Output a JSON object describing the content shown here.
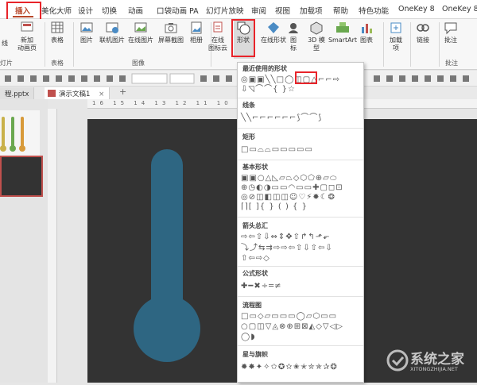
{
  "tabs": [
    "插入",
    "美化大师",
    "设计",
    "切换",
    "动画",
    "口袋动画 PA",
    "幻灯片放映",
    "审阅",
    "视图",
    "加载项",
    "帮助",
    "特色功能",
    "OneKey 8",
    "OneKey 8"
  ],
  "ribbon": {
    "b0": "线",
    "b0b": "片",
    "b1": "新加",
    "b1b": "动画页",
    "b2": "表格",
    "b3": "图片",
    "b4": "联机图片",
    "b5": "在线图片",
    "b6": "屏幕截图",
    "b7": "相册",
    "b8": "在线",
    "b8b": "图标云",
    "b9": "形状",
    "b10": "在线形状",
    "b11": "图",
    "b11b": "标",
    "b12": "3D 模",
    "b12b": "型",
    "b13": "SmartArt",
    "b14": "图表",
    "b15": "加载",
    "b15b": "项",
    "b16": "链接",
    "b17": "批注",
    "g0": "灯片",
    "g1": "表格",
    "g2": "图像",
    "g3": "批注"
  },
  "files": {
    "f1": "程.pptx",
    "f2": "演示文稿1",
    "close": "×",
    "add": "+"
  },
  "ruler": "16 15 14 13 12 11 10 9 8 7 6 5",
  "menu": {
    "recent": "最近使用的形状",
    "recent_r1": "◎▣▣╲╲□◯◫▢△⌐⌐⇨",
    "recent_r2": "⇩◹⌒⌒{ }☆",
    "lines": "线条",
    "lines_r1": "╲╲⌐⌐⌐⌐⌐⌐⟆⌒⌒⟆",
    "rect": "矩形",
    "rect_r1": "□▭⌓⌓▭▭▭▭▭",
    "basic": "基本形状",
    "basic_r1": "▣▣○△◺▱⏢◇⬡⬠⊕▱⬭",
    "basic_r2": "⊕◷◐◑▭▭◠▭▭✚▢◻⊡",
    "basic_r3": "◎⊘◫◧◫◫☺♡⚡✹☾❂",
    "basic_r4": "⌈⌉[ ]{ } ( ) { }",
    "arrows": "箭头总汇",
    "arrows_r1": "⇨⇦⇧⇩⇔⇕✥⇧↱↰⬏⬐",
    "arrows_r2": "⤵⤴⇆⇉⇨⇨⇦⇧⇩⇧⇦⇩",
    "arrows_r3": "⇧⇦⇨◇",
    "formula": "公式形状",
    "formula_r1": "✚━✖÷═≠",
    "flow": "流程图",
    "flow_r1": "□▭◇▱▭▭▭◯▱⬡▭▭",
    "flow_r2": "○▢◫▽◬⊗⊕⊞⊠◭◇▽◁▷",
    "flow_r3": "◯◗",
    "stars": "星与旗帜",
    "stars_r1": "✹✸✦✧✩✪✫✬✭✮✯✰❂"
  },
  "watermark": {
    "cn": "系统之家",
    "en": "XITONGZHIJIA.NET"
  },
  "colors": {
    "accent": "#c0504d",
    "slide_bg": "#333333",
    "thermo": "#2e6682",
    "highlight": "#e8242a"
  }
}
